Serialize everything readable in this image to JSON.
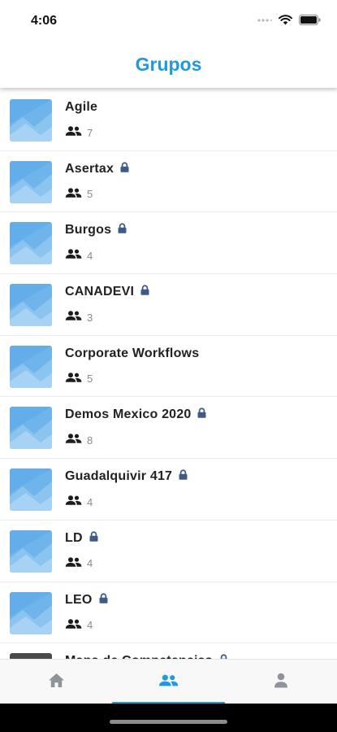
{
  "status": {
    "time": "4:06",
    "icons": [
      "cellular-dots-icon",
      "wifi-icon",
      "battery-icon"
    ]
  },
  "header": {
    "title": "Grupos"
  },
  "colors": {
    "accent": "#1f9ae0",
    "text": "#222222",
    "muted": "#8a8a8a",
    "thumb": "#6fb5ec",
    "lock": "#3f5a86"
  },
  "groups": [
    {
      "name": "Agile",
      "members": "7",
      "locked": false
    },
    {
      "name": "Asertax",
      "members": "5",
      "locked": true
    },
    {
      "name": "Burgos",
      "members": "4",
      "locked": true
    },
    {
      "name": "CANADEVI",
      "members": "3",
      "locked": true
    },
    {
      "name": "Corporate Workflows",
      "members": "5",
      "locked": false
    },
    {
      "name": "Demos Mexico 2020",
      "members": "8",
      "locked": true
    },
    {
      "name": "Guadalquivir 417",
      "members": "4",
      "locked": true
    },
    {
      "name": "LD",
      "members": "4",
      "locked": true
    },
    {
      "name": "LEO",
      "members": "4",
      "locked": true
    },
    {
      "name": "Mapa de Competencias",
      "members": "",
      "locked": true
    }
  ],
  "tabs": [
    {
      "icon": "home-icon",
      "active": false
    },
    {
      "icon": "group-icon",
      "active": true
    },
    {
      "icon": "person-icon",
      "active": false
    }
  ]
}
